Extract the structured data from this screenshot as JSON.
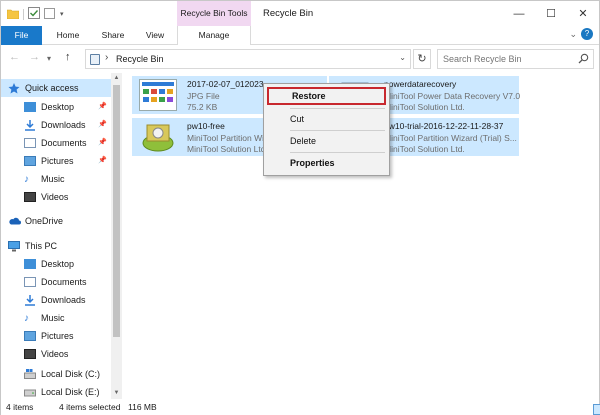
{
  "window": {
    "contextual_group": "Recycle Bin Tools",
    "title": "Recycle Bin",
    "controls": {
      "minimize": "—",
      "maximize": "☐",
      "close": "✕"
    }
  },
  "ribbon": {
    "tabs": [
      "File",
      "Home",
      "Share",
      "View",
      "Manage"
    ]
  },
  "address": {
    "separator": "›",
    "path": "Recycle Bin",
    "search_placeholder": "Search Recycle Bin"
  },
  "nav_pane": {
    "quick_access": {
      "label": "Quick access",
      "items": [
        {
          "label": "Desktop",
          "pinned": true
        },
        {
          "label": "Downloads",
          "pinned": true
        },
        {
          "label": "Documents",
          "pinned": true
        },
        {
          "label": "Pictures",
          "pinned": true
        },
        {
          "label": "Music",
          "pinned": false
        },
        {
          "label": "Videos",
          "pinned": false
        }
      ]
    },
    "onedrive": "OneDrive",
    "this_pc": {
      "label": "This PC",
      "items": [
        "Desktop",
        "Documents",
        "Downloads",
        "Music",
        "Pictures",
        "Videos",
        "Local Disk (C:)",
        "Local Disk (E:)"
      ]
    }
  },
  "files": [
    {
      "name": "2017-02-07_012023",
      "type": "JPG File",
      "detail": "75.2 KB",
      "icon": "jpg-thumbnail-icon"
    },
    {
      "name": "powerdatarecovery",
      "type": "MiniTool Power Data Recovery V7.0",
      "detail": "MiniTool Solution Ltd.",
      "icon": "power-data-recovery-icon"
    },
    {
      "name": "pw10-free",
      "type": "MiniTool Partition Wizard",
      "detail": "MiniTool Solution Ltd.",
      "icon": "partition-wizard-icon"
    },
    {
      "name": "pw10-trial-2016-12-22-11-28-37",
      "type": "MiniTool Partition Wizard (Trial) S...",
      "detail": "MiniTool Solution Ltd.",
      "icon": "partition-wizard-icon"
    }
  ],
  "context_menu": {
    "items": [
      "Restore",
      "Cut",
      "Delete",
      "Properties"
    ]
  },
  "status": {
    "items_count": "4 items",
    "selected": "4 items selected",
    "size": "116 MB"
  },
  "colors": {
    "file_tab": "#1979ca",
    "contextual_tab": "#f1d8f1",
    "selection": "#cce8ff",
    "restore_highlight": "#c8282e"
  }
}
